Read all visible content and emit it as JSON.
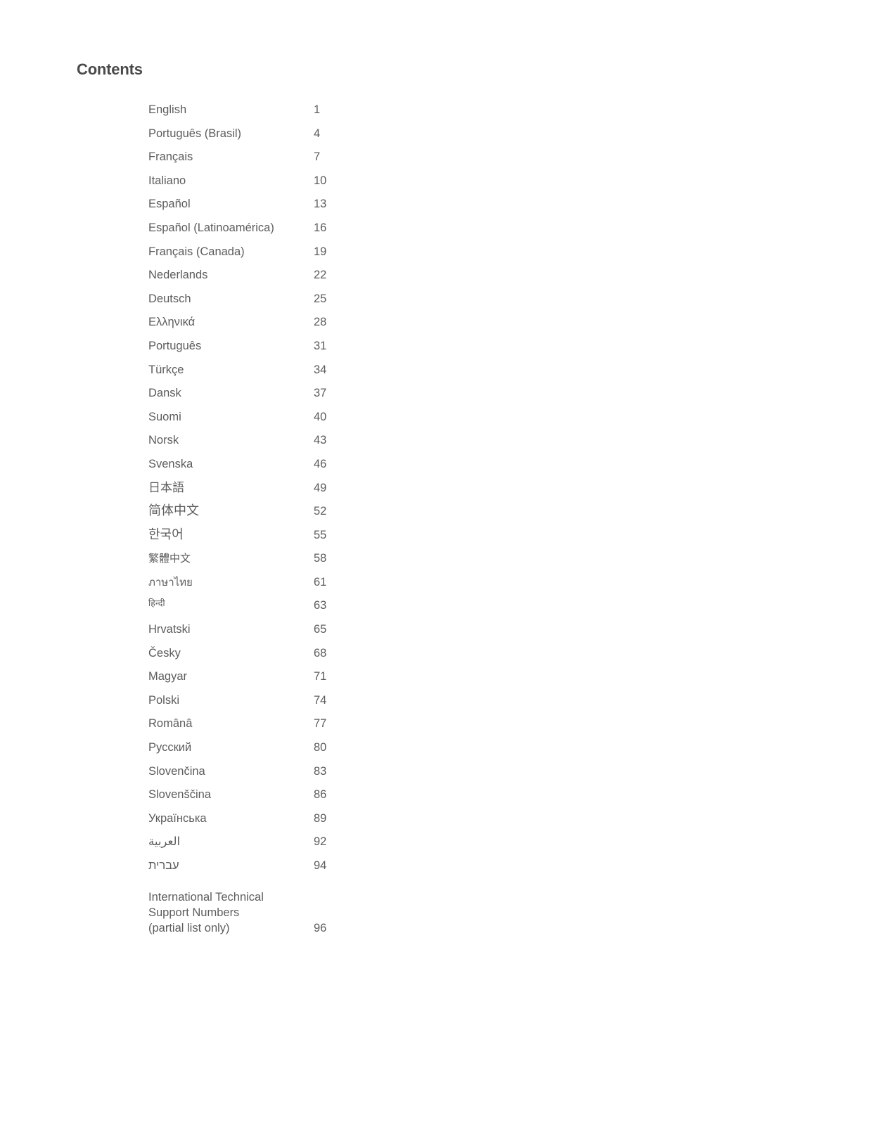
{
  "document": {
    "heading": "Contents",
    "text_color": "#5c5c5c",
    "heading_color": "#4a4a4a",
    "background_color": "#ffffff"
  },
  "toc": {
    "entries": [
      {
        "label": "English",
        "page": "1",
        "script": "latin"
      },
      {
        "label": "Português (Brasil)",
        "page": "4",
        "script": "latin"
      },
      {
        "label": "Français",
        "page": "7",
        "script": "latin"
      },
      {
        "label": "Italiano",
        "page": "10",
        "script": "latin"
      },
      {
        "label": "Español",
        "page": "13",
        "script": "latin"
      },
      {
        "label": "Español (Latinoamérica)",
        "page": "16",
        "script": "latin"
      },
      {
        "label": "Français (Canada)",
        "page": "19",
        "script": "latin"
      },
      {
        "label": "Nederlands",
        "page": "22",
        "script": "latin"
      },
      {
        "label": "Deutsch",
        "page": "25",
        "script": "latin"
      },
      {
        "label": "Ελληνικά",
        "page": "28",
        "script": "greek"
      },
      {
        "label": "Português",
        "page": "31",
        "script": "latin"
      },
      {
        "label": "Türkçe",
        "page": "34",
        "script": "latin"
      },
      {
        "label": "Dansk",
        "page": "37",
        "script": "latin"
      },
      {
        "label": "Suomi",
        "page": "40",
        "script": "latin"
      },
      {
        "label": "Norsk",
        "page": "43",
        "script": "latin"
      },
      {
        "label": "Svenska",
        "page": "46",
        "script": "latin"
      },
      {
        "label": "日本語",
        "page": "49",
        "script": "jpan"
      },
      {
        "label": "简体中文",
        "page": "52",
        "script": "hans"
      },
      {
        "label": "한국어",
        "page": "55",
        "script": "hang"
      },
      {
        "label": "繁體中文",
        "page": "58",
        "script": "hant"
      },
      {
        "label": "ภาษาไทย",
        "page": "61",
        "script": "thai"
      },
      {
        "label": "हिन्दी",
        "page": "63",
        "script": "hindi"
      },
      {
        "label": "Hrvatski",
        "page": "65",
        "script": "latin"
      },
      {
        "label": "Česky",
        "page": "68",
        "script": "latin"
      },
      {
        "label": "Magyar",
        "page": "71",
        "script": "latin"
      },
      {
        "label": "Polski",
        "page": "74",
        "script": "latin"
      },
      {
        "label": "Românâ",
        "page": "77",
        "script": "latin"
      },
      {
        "label": "Русский",
        "page": "80",
        "script": "cyrillic"
      },
      {
        "label": "Slovenčina",
        "page": "83",
        "script": "latin"
      },
      {
        "label": "Slovenščina",
        "page": "86",
        "script": "latin"
      },
      {
        "label": "Українська",
        "page": "89",
        "script": "cyrillic"
      },
      {
        "label": "العربية",
        "page": "92",
        "script": "rtl"
      },
      {
        "label": "עברית",
        "page": "94",
        "script": "rtl"
      },
      {
        "label": "International Technical\nSupport Numbers\n(partial list only)",
        "page": "96",
        "script": "latin",
        "multiline": true
      }
    ]
  }
}
